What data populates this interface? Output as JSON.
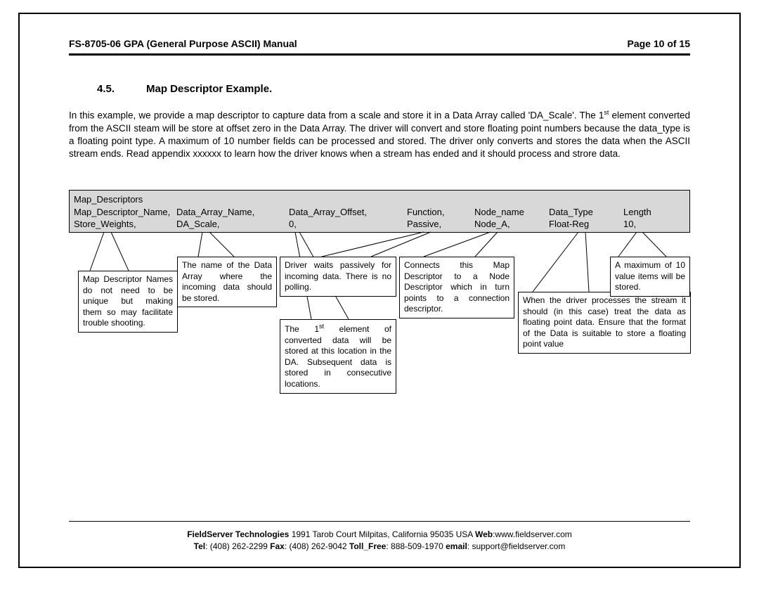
{
  "header": {
    "left": "FS-8705-06 GPA (General Purpose ASCII) Manual",
    "right": "Page 10 of 15"
  },
  "section": {
    "number": "4.5.",
    "title": "Map Descriptor Example."
  },
  "body": {
    "p1a": "In this example, we provide a map descriptor to capture data from a scale and store it in a Data Array called 'DA_Scale'. The 1",
    "p1sup": "st",
    "p1b": " element converted from the ASCII steam will be store at offset zero in the Data Array. The driver will convert and store floating point numbers because the data_type is a floating point type. A maximum of 10 number fields can be processed and stored. The driver only converts and stores the data when the ASCII stream ends. Read appendix xxxxxx to learn how the driver knows when a stream has ended and it should process and strore data."
  },
  "table": {
    "heading": "Map_Descriptors",
    "cols": [
      "Map_Descriptor_Name,",
      "Data_Array_Name,",
      "Data_Array_Offset,",
      "Function,",
      "Node_name",
      "Data_Type",
      "Length"
    ],
    "vals": [
      "Store_Weights,",
      "DA_Scale,",
      "0,",
      "Passive,",
      "Node_A,",
      "Float-Reg",
      "10,"
    ]
  },
  "callouts": {
    "c1": "Map Descriptor Names do not need to be unique but making them so may facilitate trouble shooting.",
    "c2": "The name of the Data Array where the incoming data should be stored.",
    "c3": "Driver waits passively for incoming data. There is no polling.",
    "c4a": "The 1",
    "c4sup": "st",
    "c4b": " element of converted data will be stored at this location in the DA. Subsequent data is stored in consecutive locations.",
    "c5": "Connects this Map Descriptor to a Node Descriptor which in turn points to a connection descriptor.",
    "c6": "When the driver processes the stream it should (in this case) treat the data as floating point data. Ensure that the format of the Data is suitable to store a floating point value",
    "c7": "A maximum of 10 value items will be stored."
  },
  "footer": {
    "l1a": "FieldServer Technologies",
    "l1b": " 1991 Tarob Court Milpitas, California 95035 USA  ",
    "l1c": "Web",
    "l1d": ":www.fieldserver.com",
    "l2a": "Tel",
    "l2b": ": (408) 262-2299  ",
    "l2c": "Fax",
    "l2d": ": (408) 262-9042  ",
    "l2e": "Toll_Free",
    "l2f": ": 888-509-1970  ",
    "l2g": "email",
    "l2h": ": support@fieldserver.com"
  }
}
